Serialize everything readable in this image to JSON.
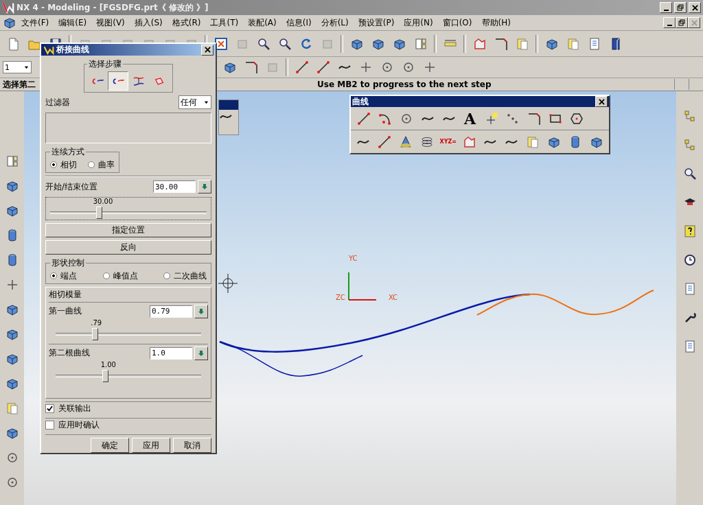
{
  "window": {
    "title": "NX 4 - Modeling - [FGSDFG.prt《 修改的 》]"
  },
  "menu": [
    "文件(F)",
    "编辑(E)",
    "视图(V)",
    "插入(S)",
    "格式(R)",
    "工具(T)",
    "装配(A)",
    "信息(I)",
    "分析(L)",
    "预设置(P)",
    "应用(N)",
    "窗口(O)",
    "帮助(H)"
  ],
  "toolbar": {
    "layer_value": "1"
  },
  "status_bar": {
    "prompt": "选择第二",
    "message": "Use MB2 to progress to the next step"
  },
  "dialog": {
    "title": "桥接曲线",
    "step_group": "选择步骤",
    "steps": [
      {
        "selected": false
      },
      {
        "selected": true
      },
      {
        "selected": false
      },
      {
        "selected": false
      }
    ],
    "filter_label": "过滤器",
    "filter_value": "任何",
    "continuity": {
      "label": "连续方式",
      "options": [
        {
          "label": "相切",
          "selected": true
        },
        {
          "label": "曲率",
          "selected": false
        }
      ]
    },
    "position": {
      "label": "开始/结束位置",
      "value": "30.00",
      "reading": "30.00",
      "level": 0.31
    },
    "specify_button": "指定位置",
    "reverse_button": "反向",
    "shape": {
      "label": "形状控制",
      "options": [
        {
          "label": "端点",
          "selected": true
        },
        {
          "label": "峰值点",
          "selected": false
        },
        {
          "label": "二次曲线",
          "selected": false
        }
      ]
    },
    "tangent": {
      "label": "相切模量",
      "sliders": [
        {
          "label": "第一曲线",
          "value": "0.79",
          "reading": ".79",
          "level": 0.27
        },
        {
          "label": "第二根曲线",
          "value": "1.0",
          "reading": "1.00",
          "level": 0.34
        }
      ]
    },
    "checks": [
      {
        "label": "关联输出",
        "checked": true
      },
      {
        "label": "应用时确认",
        "checked": false
      }
    ],
    "buttons": [
      "确定",
      "应用",
      "取消"
    ]
  },
  "curve_toolbar": {
    "title": "曲线",
    "text_tool": "A",
    "law_tool": "XYZ="
  },
  "canvas": {
    "y_axis": "YC",
    "x_axis": "XC",
    "z_axis": "ZC"
  }
}
